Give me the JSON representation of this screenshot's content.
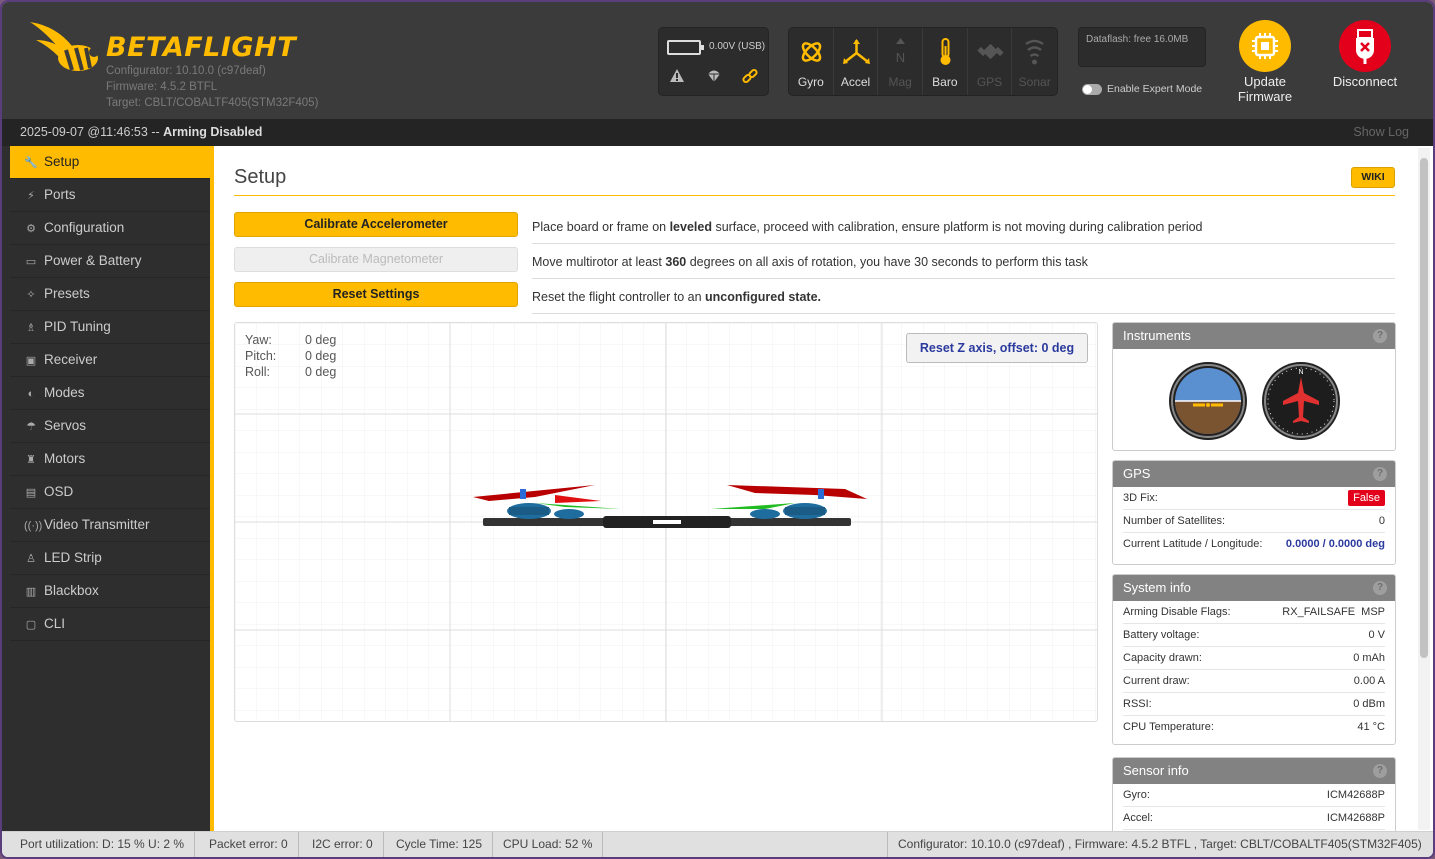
{
  "header": {
    "logo_text": "BETAFLIGHT",
    "configurator": "Configurator: 10.10.0 (c97deaf)",
    "firmware": "Firmware: 4.5.2 BTFL",
    "target": "Target: CBLT/COBALTF405(STM32F405)",
    "battery_text": "0.00V (USB)",
    "sensors": [
      {
        "label": "Gyro",
        "active": true,
        "icon": "gyro-icon"
      },
      {
        "label": "Accel",
        "active": true,
        "icon": "accel-icon"
      },
      {
        "label": "Mag",
        "active": false,
        "icon": "mag-icon"
      },
      {
        "label": "Baro",
        "active": true,
        "icon": "baro-icon"
      },
      {
        "label": "GPS",
        "active": false,
        "icon": "gps-icon"
      },
      {
        "label": "Sonar",
        "active": false,
        "icon": "sonar-icon"
      }
    ],
    "dataflash": "Dataflash: free 16.0MB",
    "expert_mode": "Enable Expert Mode",
    "update_firmware": [
      "Update",
      "Firmware"
    ],
    "disconnect": "Disconnect"
  },
  "status": {
    "timestamp": "2025-09-07 @11:46:53",
    "separator": " -- ",
    "state": "Arming Disabled",
    "show_log": "Show Log"
  },
  "sidebar": {
    "items": [
      {
        "label": "Setup",
        "icon": "wrench-icon",
        "active": true
      },
      {
        "label": "Ports",
        "icon": "plug-icon"
      },
      {
        "label": "Configuration",
        "icon": "gear-icon"
      },
      {
        "label": "Power & Battery",
        "icon": "battery-icon"
      },
      {
        "label": "Presets",
        "icon": "presets-icon"
      },
      {
        "label": "PID Tuning",
        "icon": "pid-icon"
      },
      {
        "label": "Receiver",
        "icon": "receiver-icon"
      },
      {
        "label": "Modes",
        "icon": "modes-icon"
      },
      {
        "label": "Servos",
        "icon": "servo-icon"
      },
      {
        "label": "Motors",
        "icon": "motor-icon"
      },
      {
        "label": "OSD",
        "icon": "osd-icon"
      },
      {
        "label": "Video Transmitter",
        "icon": "vtx-icon"
      },
      {
        "label": "LED Strip",
        "icon": "led-icon"
      },
      {
        "label": "Blackbox",
        "icon": "blackbox-icon"
      },
      {
        "label": "CLI",
        "icon": "cli-icon"
      }
    ]
  },
  "setup": {
    "title": "Setup",
    "wiki": "WIKI",
    "actions": [
      {
        "button": "Calibrate Accelerometer",
        "enabled": true,
        "desc_pre": "Place board or frame on ",
        "desc_bold": "leveled",
        "desc_post": " surface, proceed with calibration, ensure platform is not moving during calibration period"
      },
      {
        "button": "Calibrate Magnetometer",
        "enabled": false,
        "desc_pre": "Move multirotor at least ",
        "desc_bold": "360",
        "desc_post": " degrees on all axis of rotation, you have 30 seconds to perform this task"
      },
      {
        "button": "Reset Settings",
        "enabled": true,
        "desc_pre": "Reset the flight controller to an ",
        "desc_bold": "unconfigured state.",
        "desc_post": ""
      }
    ],
    "attitude": {
      "yaw_label": "Yaw:",
      "yaw": "0 deg",
      "pitch_label": "Pitch:",
      "pitch": "0 deg",
      "roll_label": "Roll:",
      "roll": "0 deg"
    },
    "reset_z": "Reset Z axis, offset: 0 deg"
  },
  "instruments": {
    "title": "Instruments"
  },
  "gps": {
    "title": "GPS",
    "rows": [
      {
        "label": "3D Fix:",
        "value": "False"
      },
      {
        "label": "Number of Satellites:",
        "value": "0"
      },
      {
        "label": "Current Latitude / Longitude:",
        "value": "0.0000 / 0.0000 deg"
      }
    ]
  },
  "system_info": {
    "title": "System info",
    "rows": [
      {
        "label": "Arming Disable Flags:",
        "value": "RX_FAILSAFE  MSP"
      },
      {
        "label": "Battery voltage:",
        "value": "0 V"
      },
      {
        "label": "Capacity drawn:",
        "value": "0 mAh"
      },
      {
        "label": "Current draw:",
        "value": "0.00 A"
      },
      {
        "label": "RSSI:",
        "value": "0 dBm"
      },
      {
        "label": "CPU Temperature:",
        "value": "41 °C"
      }
    ]
  },
  "sensor_info": {
    "title": "Sensor info",
    "rows": [
      {
        "label": "Gyro:",
        "value": "ICM42688P"
      },
      {
        "label": "Accel:",
        "value": "ICM42688P"
      }
    ]
  },
  "footer": {
    "port_util": "Port utilization: D: 15 % U: 2 %",
    "packet_error": "Packet error: 0",
    "i2c_error": "I2C error: 0",
    "cycle_time": "Cycle Time: 125",
    "cpu_load": "CPU Load: 52 %",
    "version": "Configurator: 10.10.0 (c97deaf) , Firmware: 4.5.2 BTFL , Target: CBLT/COBALTF405(STM32F405)"
  },
  "colors": {
    "accent": "#ffbb00",
    "header": "#3b3b3b",
    "sidebar": "#2e2e2e",
    "danger": "#e2001a"
  }
}
